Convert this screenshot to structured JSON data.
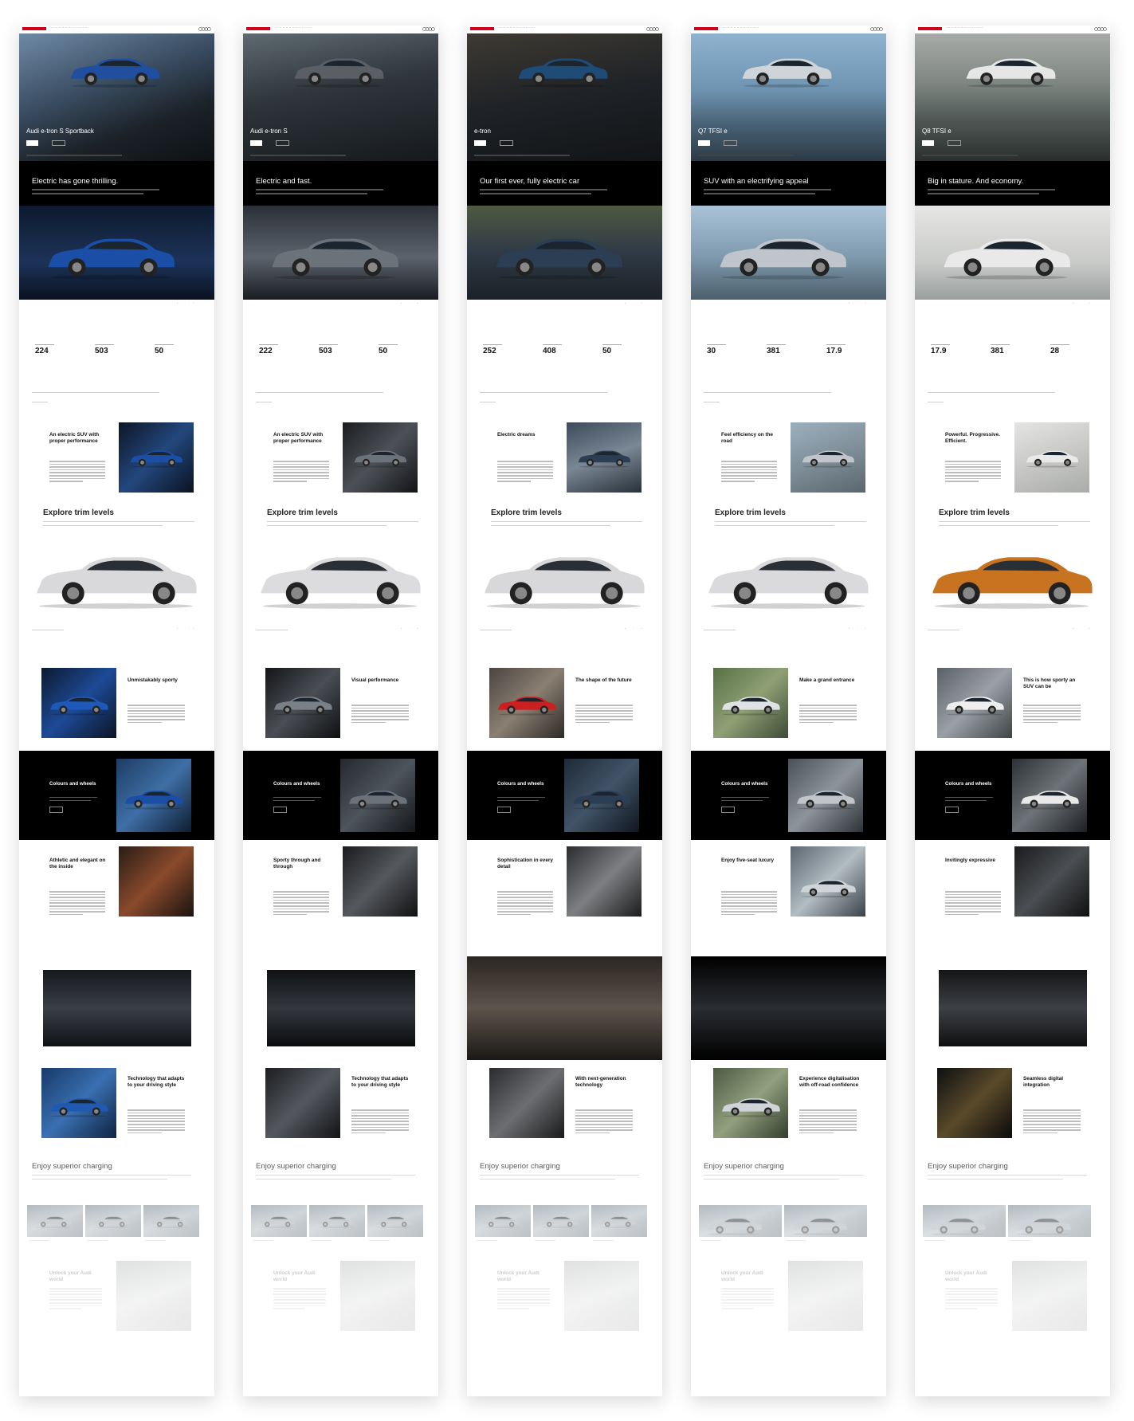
{
  "pages": [
    {
      "model": "Audi e-tron S Sportback",
      "headline": "Electric has gone thrilling.",
      "stats": [
        {
          "value": "224"
        },
        {
          "value": "503"
        },
        {
          "value": "50"
        }
      ],
      "intro_title": "An electric SUV with proper performance",
      "trims_title": "Explore trim levels",
      "trim_car_color": "#d9d9dc",
      "feature_title": "Unmistakably sporty",
      "colours_title": "Colours and wheels",
      "interior_title": "Athletic and elegant on the inside",
      "tech_title": "Technology that adapts to your driving style",
      "charging_title": "Enjoy superior charging",
      "app_title": "Unlock your Audi world"
    },
    {
      "model": "Audi e-tron S",
      "headline": "Electric and fast.",
      "stats": [
        {
          "value": "222"
        },
        {
          "value": "503"
        },
        {
          "value": "50"
        }
      ],
      "intro_title": "An electric SUV with proper performance",
      "trims_title": "Explore trim levels",
      "trim_car_color": "#dcdcde",
      "feature_title": "Visual performance",
      "colours_title": "Colours and wheels",
      "interior_title": "Sporty through and through",
      "tech_title": "Technology that adapts to your driving style",
      "charging_title": "Enjoy superior charging",
      "app_title": "Unlock your Audi world"
    },
    {
      "model": "e-tron",
      "headline": "Our first ever, fully electric car",
      "stats": [
        {
          "value": "252"
        },
        {
          "value": "408"
        },
        {
          "value": "50"
        }
      ],
      "intro_title": "Electric dreams",
      "trims_title": "Explore trim levels",
      "trim_car_color": "#d8d8da",
      "feature_title": "The shape of the future",
      "colours_title": "Colours and wheels",
      "interior_title": "Sophistication in every detail",
      "tech_title": "With next-generation technology",
      "charging_title": "Enjoy superior charging",
      "app_title": "Unlock your Audi world"
    },
    {
      "model": "Q7 TFSI e",
      "headline": "SUV with an electrifying appeal",
      "stats": [
        {
          "value": "30"
        },
        {
          "value": "381"
        },
        {
          "value": "17.9"
        }
      ],
      "intro_title": "Feel efficiency on the road",
      "trims_title": "Explore trim levels",
      "trim_car_color": "#dadadc",
      "feature_title": "Make a grand entrance",
      "colours_title": "Colours and wheels",
      "interior_title": "Enjoy five-seat luxury",
      "tech_title": "Experience digitalisation with off-road confidence",
      "charging_title": "Enjoy superior charging",
      "app_title": "Unlock your Audi world"
    },
    {
      "model": "Q8 TFSI e",
      "headline": "Big in stature. And economy.",
      "stats": [
        {
          "value": "17.9"
        },
        {
          "value": "381"
        },
        {
          "value": "28"
        }
      ],
      "intro_title": "Powerful. Progressive. Efficient.",
      "trims_title": "Explore trim levels",
      "trim_car_color": "#c8731f",
      "feature_title": "This is how sporty an SUV can be",
      "colours_title": "Colours and wheels",
      "interior_title": "Invitingly expressive",
      "tech_title": "Seamless digital integration",
      "charging_title": "Enjoy superior charging",
      "app_title": "Unlock your Audi world"
    }
  ]
}
